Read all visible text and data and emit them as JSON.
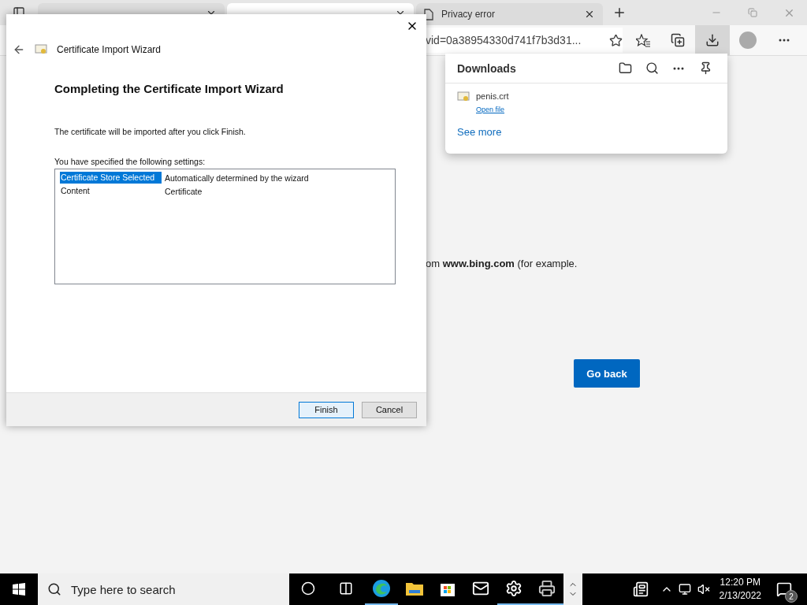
{
  "browser": {
    "tabs": [
      {
        "selected": false
      },
      {
        "selected": true
      },
      {
        "label": "Privacy error",
        "selected": false
      }
    ],
    "address": "vid=0a38954330d741f7b3d31...",
    "downloads_active": true,
    "page_text": "om **www.bing.com** (for example.",
    "go_back": "Go back"
  },
  "downloads": {
    "title": "Downloads",
    "items": [
      {
        "file": "penis.crt",
        "action": "Open file"
      }
    ],
    "see_more": "See more"
  },
  "wizard": {
    "title": "Certificate Import Wizard",
    "heading": "Completing the Certificate Import Wizard",
    "intro": "The certificate will be imported after you click Finish.",
    "settings_label": "You have specified the following settings:",
    "settings": [
      {
        "name": "Certificate Store Selected",
        "value": "Automatically determined by the wizard",
        "selected": true
      },
      {
        "name": "Content",
        "value": "Certificate",
        "selected": false
      }
    ],
    "buttons": [
      {
        "label": "Finish",
        "default": true
      },
      {
        "label": "Cancel",
        "default": false
      }
    ]
  },
  "taskbar": {
    "search_placeholder": "Type here to search",
    "apps": [
      {
        "kind": "cortana",
        "running": false
      },
      {
        "kind": "taskview",
        "running": false
      },
      {
        "kind": "edge",
        "running": true
      },
      {
        "kind": "explorer",
        "running": false
      },
      {
        "kind": "store",
        "running": false
      },
      {
        "kind": "mail",
        "running": false
      },
      {
        "kind": "settings",
        "running": true
      },
      {
        "kind": "app",
        "running": true
      }
    ],
    "time": "12:20 PM",
    "date": "2/13/2022",
    "notifications": "2"
  }
}
